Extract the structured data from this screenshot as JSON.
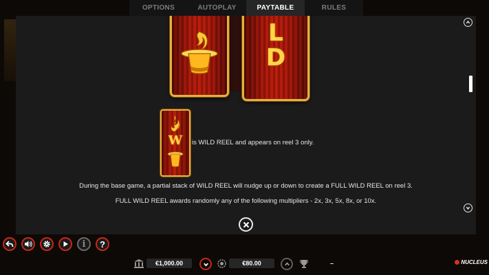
{
  "tabs": [
    {
      "label": "OPTIONS",
      "active": false
    },
    {
      "label": "AUTOPLAY",
      "active": false
    },
    {
      "label": "PAYTABLE",
      "active": true
    },
    {
      "label": "RULES",
      "active": false
    }
  ],
  "reel_letters": [
    "L",
    "D"
  ],
  "small_reel_letter": "W",
  "paytable": {
    "wild_desc": "is WILD REEL and appears on reel 3 only.",
    "base_game_desc": "During the base game, a partial stack of WILD REEL will nudge up or down to create a FULL WILD REEL on reel 3.",
    "multipliers_desc": "FULL WILD REEL awards randomly any of the following multipliers - 2x, 3x, 5x, 8x, or 10x."
  },
  "bottom_bar": {
    "balance": "€1,000.00",
    "bet": "€80.00",
    "win": "–",
    "brand": "NUCLEUS"
  },
  "colors": {
    "accent_red": "#c8261b",
    "gold": "#e5b23c",
    "panel": "#1b1b1b"
  },
  "icons": {
    "controls": [
      "back-arrow-icon",
      "sound-icon",
      "settings-gear-icon",
      "play-icon",
      "info-icon",
      "help-icon"
    ],
    "bar": [
      "bank-icon",
      "chevron-down-icon",
      "coins-icon",
      "chevron-up-icon",
      "trophy-icon"
    ]
  }
}
